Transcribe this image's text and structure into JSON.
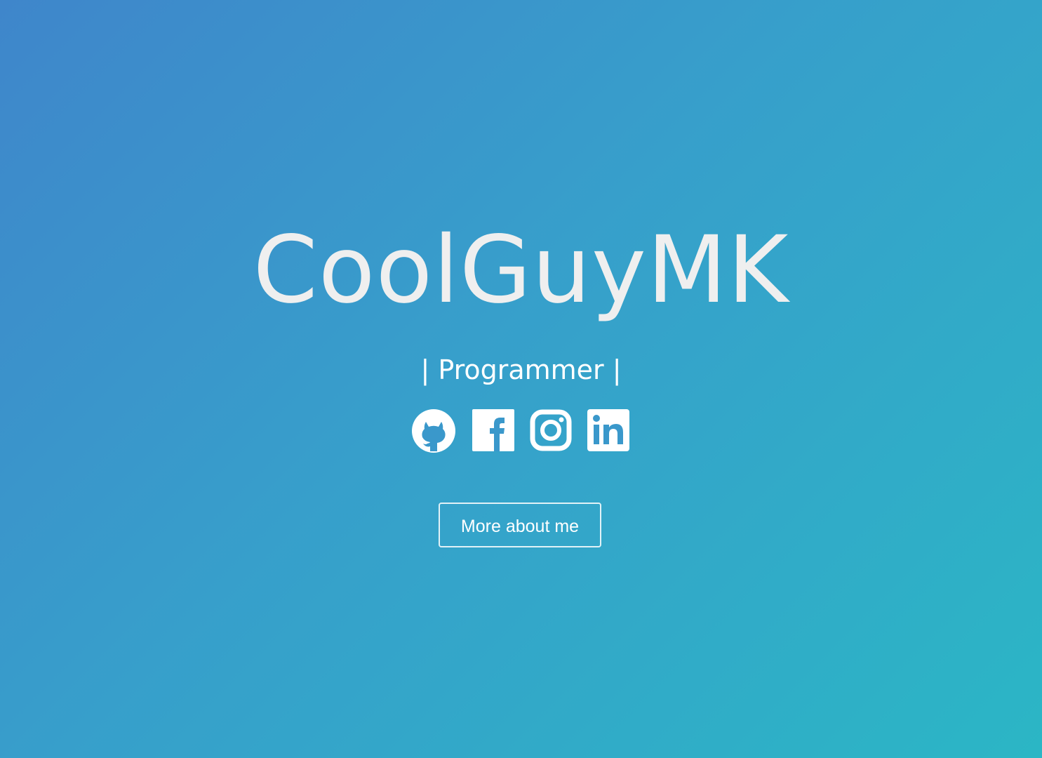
{
  "hero": {
    "title": "CoolGuyMK",
    "subtitle": "| Programmer |",
    "cta_label": "More about me"
  },
  "socials": [
    {
      "icon": "github-icon"
    },
    {
      "icon": "facebook-icon"
    },
    {
      "icon": "instagram-icon"
    },
    {
      "icon": "linkedin-icon"
    }
  ],
  "colors": {
    "gradient_start": "#3f86cb",
    "gradient_end": "#2bb6c5",
    "title_text": "#efefef",
    "text": "#ffffff"
  }
}
